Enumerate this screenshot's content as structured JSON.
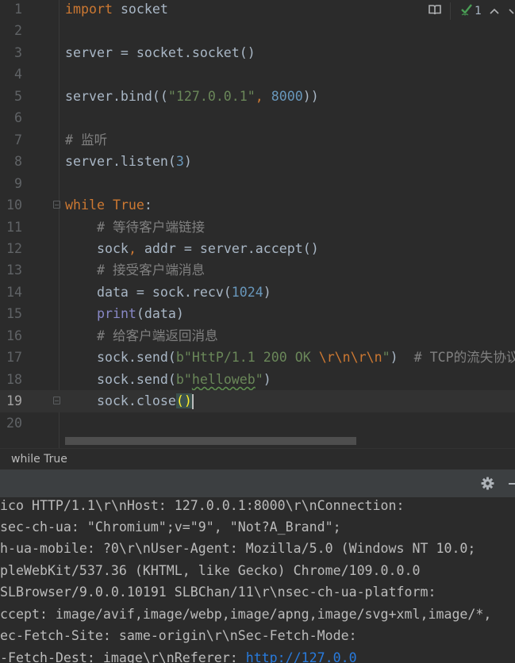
{
  "editor": {
    "current_line": 19,
    "lines": [
      {
        "n": "1",
        "tokens": [
          [
            "import",
            "kw"
          ],
          [
            " socket",
            ""
          ]
        ]
      },
      {
        "n": "2",
        "tokens": []
      },
      {
        "n": "3",
        "tokens": [
          [
            "server = socket.socket()",
            ""
          ]
        ]
      },
      {
        "n": "4",
        "tokens": []
      },
      {
        "n": "5",
        "tokens": [
          [
            "server.bind((",
            ""
          ],
          [
            "\"127.0.0.1\"",
            "str"
          ],
          [
            ", ",
            "kw"
          ],
          [
            "8000",
            "num"
          ],
          [
            "))",
            ""
          ]
        ]
      },
      {
        "n": "6",
        "tokens": []
      },
      {
        "n": "7",
        "tokens": [
          [
            "# 监听",
            "cm"
          ]
        ]
      },
      {
        "n": "8",
        "tokens": [
          [
            "server.listen(",
            ""
          ],
          [
            "3",
            "num"
          ],
          [
            ")",
            ""
          ]
        ]
      },
      {
        "n": "9",
        "tokens": []
      },
      {
        "n": "10",
        "tokens": [
          [
            "while",
            "kw"
          ],
          [
            " ",
            ""
          ],
          [
            "True",
            "kw"
          ],
          [
            ":",
            ""
          ]
        ]
      },
      {
        "n": "11",
        "tokens": [
          [
            "    ",
            ""
          ],
          [
            "# 等待客户端链接",
            "cm"
          ]
        ]
      },
      {
        "n": "12",
        "tokens": [
          [
            "    sock",
            ""
          ],
          [
            ",",
            "kw"
          ],
          [
            " addr = server.accept()",
            ""
          ]
        ]
      },
      {
        "n": "13",
        "tokens": [
          [
            "    ",
            ""
          ],
          [
            "# 接受客户端消息",
            "cm"
          ]
        ]
      },
      {
        "n": "14",
        "tokens": [
          [
            "    data = sock.recv(",
            ""
          ],
          [
            "1024",
            "num"
          ],
          [
            ")",
            ""
          ]
        ]
      },
      {
        "n": "15",
        "tokens": [
          [
            "    ",
            ""
          ],
          [
            "print",
            "bi"
          ],
          [
            "(data)",
            ""
          ]
        ]
      },
      {
        "n": "16",
        "tokens": [
          [
            "    ",
            ""
          ],
          [
            "# 给客户端返回消息",
            "cm"
          ]
        ]
      },
      {
        "n": "17",
        "tokens": [
          [
            "    sock.send(",
            ""
          ],
          [
            "b\"HttP/1.1 200 OK ",
            "str"
          ],
          [
            "\\r\\n\\r\\n",
            "esc"
          ],
          [
            "\"",
            "str"
          ],
          [
            ")  ",
            ""
          ],
          [
            "# TCP的流失协议",
            "cm"
          ]
        ]
      },
      {
        "n": "18",
        "tokens": [
          [
            "    sock.send(",
            ""
          ],
          [
            "b\"",
            "str"
          ],
          [
            "helloweb",
            "str typo"
          ],
          [
            "\"",
            "str"
          ],
          [
            ")",
            ""
          ]
        ]
      },
      {
        "n": "19",
        "tokens": [
          [
            "    sock.close",
            ""
          ],
          [
            "()",
            "brace"
          ],
          [
            "",
            "caret"
          ]
        ]
      },
      {
        "n": "20",
        "tokens": []
      }
    ]
  },
  "inspection": {
    "reader_mode_icon": "book-icon",
    "ok_icon": "check-icon",
    "count": "1",
    "up_icon": "chevron-up-icon",
    "down_icon": "chevron-down-icon",
    "ok_color": "#499c54"
  },
  "breadcrumb": {
    "label": "while True"
  },
  "console_toolbar": {
    "settings_icon": "gear-icon",
    "minimize_icon": "minimize-icon"
  },
  "console": {
    "lines": [
      {
        "text": "ico HTTP/1.1\\r\\nHost: 127.0.0.1:8000\\r\\nConnection:"
      },
      {
        "text": "sec-ch-ua: \"Chromium\";v=\"9\", \"Not?A_Brand\";"
      },
      {
        "text": "h-ua-mobile: ?0\\r\\nUser-Agent: Mozilla/5.0 (Windows NT 10.0;"
      },
      {
        "text": "pleWebKit/537.36 (KHTML, like Gecko) Chrome/109.0.0.0"
      },
      {
        "text": "SLBrowser/9.0.0.10191 SLBChan/11\\r\\nsec-ch-ua-platform:"
      },
      {
        "text": "ccept: image/avif,image/webp,image/apng,image/svg+xml,image/*,"
      },
      {
        "text": "ec-Fetch-Site: same-origin\\r\\nSec-Fetch-Mode:"
      },
      {
        "text": "-Fetch-Dest: image\\r\\nReferer: ",
        "link": "http://127.0.0"
      }
    ]
  }
}
